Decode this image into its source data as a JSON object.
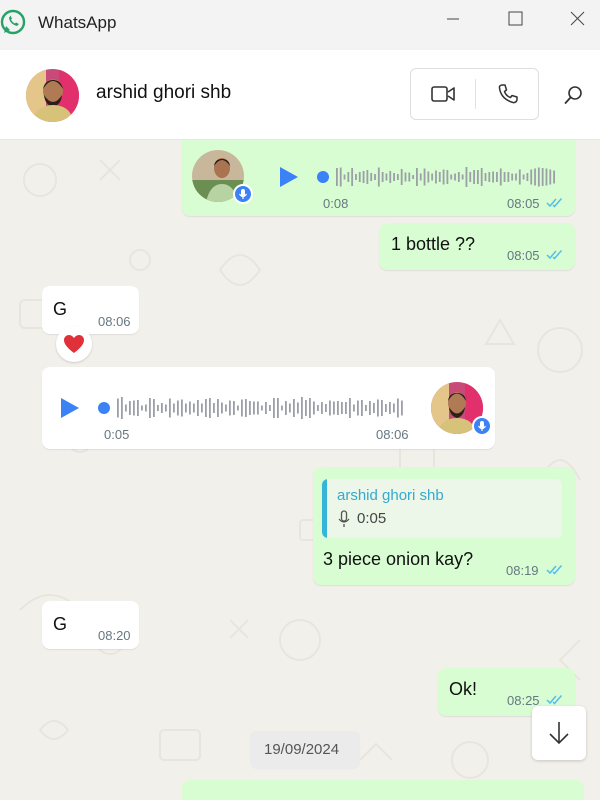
{
  "window": {
    "title": "WhatsApp"
  },
  "chat": {
    "contact_name": "arshid ghori shb"
  },
  "messages": {
    "m1": {
      "type": "voice",
      "direction": "out",
      "duration": "0:08",
      "time": "08:05"
    },
    "m2": {
      "type": "text",
      "direction": "out",
      "text": "1 bottle ??",
      "time": "08:05"
    },
    "m3": {
      "type": "text",
      "direction": "in",
      "text": "G",
      "time": "08:06",
      "reaction": "heart"
    },
    "m4": {
      "type": "voice",
      "direction": "in",
      "duration": "0:05",
      "time": "08:06"
    },
    "m5": {
      "type": "reply",
      "direction": "out",
      "quoted_name": "arshid ghori shb",
      "quoted_duration": "0:05",
      "text": "3 piece onion kay?",
      "time": "08:19"
    },
    "m6": {
      "type": "text",
      "direction": "in",
      "text": "G",
      "time": "08:20"
    },
    "m7": {
      "type": "text",
      "direction": "out",
      "text": "Ok!",
      "time": "08:25"
    }
  },
  "date_separator": "19/09/2024",
  "colors": {
    "outgoing": "#d9fdd3",
    "incoming": "#ffffff",
    "accent": "#3b82f6",
    "read_ticks": "#53bdeb",
    "quote_bar": "#35b6d8"
  },
  "icons": [
    "whatsapp-logo-icon",
    "video-call-icon",
    "voice-call-icon",
    "search-icon",
    "play-icon",
    "mic-icon",
    "heart-icon",
    "arrow-down-icon"
  ]
}
